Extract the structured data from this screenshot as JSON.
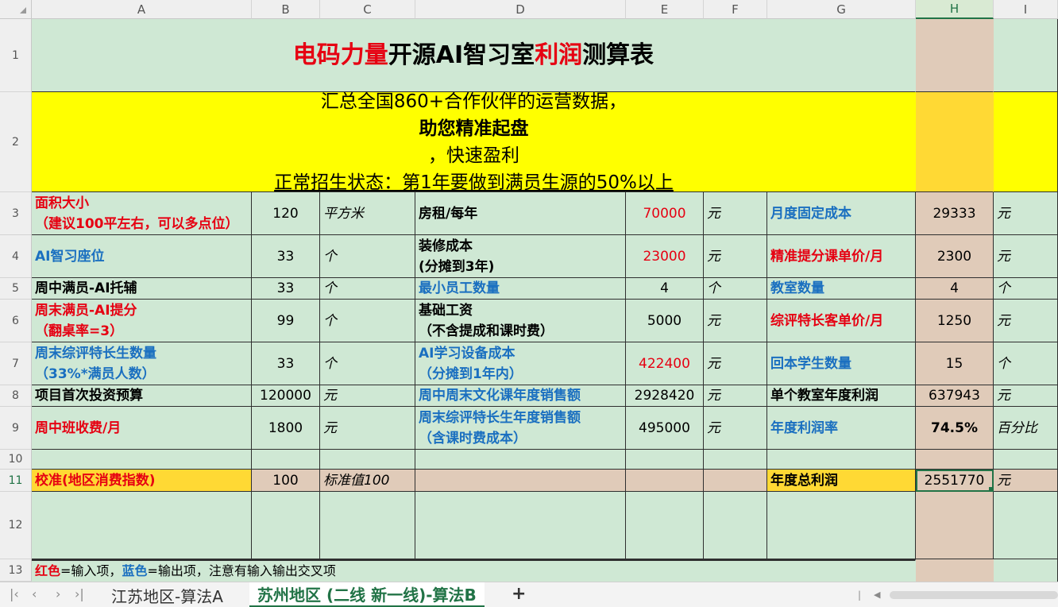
{
  "columns": [
    "A",
    "B",
    "C",
    "D",
    "E",
    "F",
    "G",
    "H",
    "I"
  ],
  "rows": [
    "1",
    "2",
    "3",
    "4",
    "5",
    "6",
    "7",
    "8",
    "9",
    "10",
    "11",
    "12",
    "13"
  ],
  "title": {
    "part1": "电码力量",
    "part2": "开源AI智习室",
    "part3": "利润",
    "part4": "测算表"
  },
  "banner": {
    "line1_a": "汇总全国860+合作伙伴的运营数据，",
    "line1_b": "助您精准起盘",
    "line1_c": "，快速盈利",
    "line2": "正常招生状态：第1年要做到满员生源的50%以上"
  },
  "r3": {
    "a1": "面积大小",
    "a2": "（建议100平左右，可以多点位）",
    "b": "120",
    "c": "平方米",
    "d": "房租/每年",
    "e": "70000",
    "f": "元",
    "g": "月度固定成本",
    "h": "29333",
    "i": "元"
  },
  "r4": {
    "a": "AI智习座位",
    "b": "33",
    "c": "个",
    "d1": "装修成本",
    "d2": "(分摊到3年)",
    "e": "23000",
    "f": "元",
    "g": "精准提分课单价/月",
    "h": "2300",
    "i": "元"
  },
  "r5": {
    "a": "周中满员-AI托辅",
    "b": "33",
    "c": "个",
    "d": "最小员工数量",
    "e": "4",
    "f": "个",
    "g": "教室数量",
    "h": "4",
    "i": "个"
  },
  "r6": {
    "a1": "周末满员-AI提分",
    "a2": "（翻桌率=3）",
    "b": "99",
    "c": "个",
    "d1": "基础工资",
    "d2": "（不含提成和课时费）",
    "e": "5000",
    "f": "元",
    "g": "综评特长客单价/月",
    "h": "1250",
    "i": "元"
  },
  "r7": {
    "a1": "周末综评特长生数量",
    "a2": "（33%*满员人数）",
    "b": "33",
    "c": "个",
    "d1": "AI学习设备成本",
    "d2": "（分摊到1年内）",
    "e": "422400",
    "f": "元",
    "g": "回本学生数量",
    "h": "15",
    "i": "个"
  },
  "r8": {
    "a": "项目首次投资预算",
    "b": "120000",
    "c": "元",
    "d": "周中周末文化课年度销售额",
    "e": "2928420",
    "f": "元",
    "g": "单个教室年度利润",
    "h": "637943",
    "i": "元"
  },
  "r9": {
    "a": "周中班收费/月",
    "b": "1800",
    "c": "元",
    "d1": "周末综评特长生年度销售额",
    "d2": "（含课时费成本）",
    "e": "495000",
    "f": "元",
    "g": "年度利润率",
    "h": "74.5%",
    "i": "百分比"
  },
  "r11": {
    "a": "校准(地区消费指数)",
    "b": "100",
    "c": "标准值100",
    "g": "年度总利润",
    "h": "2551770",
    "i": "元"
  },
  "r13": {
    "red": "红色",
    "t1": "=输入项，",
    "blue": "蓝色",
    "t2": "=输出项，注意有输入输出交叉项"
  },
  "tabs": {
    "sheet1": "江苏地区-算法A",
    "sheet2": "苏州地区 (二线 新一线)-算法B",
    "add": "+"
  },
  "colors": {
    "cell_green": "#cfe8d4",
    "tan": "#e0cbb9",
    "gold": "#ffd934",
    "banner_yellow": "#ffff00",
    "input_red": "#e60012",
    "output_blue": "#1a6fc0",
    "select_green": "#217346"
  }
}
